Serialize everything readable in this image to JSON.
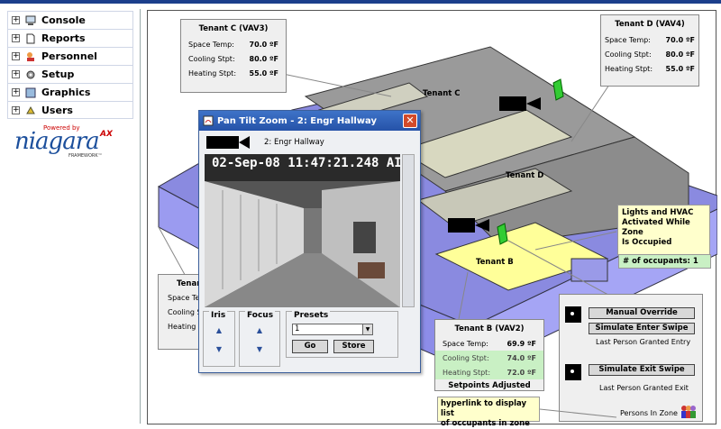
{
  "nav": {
    "items": [
      {
        "label": "Console",
        "icon": "console-icon"
      },
      {
        "label": "Reports",
        "icon": "reports-icon"
      },
      {
        "label": "Personnel",
        "icon": "personnel-icon"
      },
      {
        "label": "Setup",
        "icon": "setup-icon"
      },
      {
        "label": "Graphics",
        "icon": "graphics-icon"
      },
      {
        "label": "Users",
        "icon": "users-icon"
      }
    ],
    "expand_symbol": "+"
  },
  "logo": {
    "powered": "Powered by",
    "brand": "niagara",
    "ax": "AX",
    "framework": "FRAMEWORK™"
  },
  "floor": {
    "tenant_c": "Tenant C",
    "tenant_d": "Tenant D",
    "tenant_b": "Tenant B"
  },
  "tenant_c_box": {
    "title": "Tenant C (VAV3)",
    "rows": [
      {
        "label": "Space Temp:",
        "value": "70.0 ºF"
      },
      {
        "label": "Cooling Stpt:",
        "value": "80.0 ºF"
      },
      {
        "label": "Heating Stpt:",
        "value": "55.0 ºF"
      }
    ]
  },
  "tenant_d_box": {
    "title": "Tenant D (VAV4)",
    "rows": [
      {
        "label": "Space Temp:",
        "value": "70.0 ºF"
      },
      {
        "label": "Cooling Stpt:",
        "value": "80.0 ºF"
      },
      {
        "label": "Heating Stpt:",
        "value": "55.0 ºF"
      }
    ]
  },
  "tenant_a_box": {
    "title": "Tenan",
    "rows": [
      {
        "label": "Space Tem"
      },
      {
        "label": "Cooling St"
      },
      {
        "label": "Heating St"
      }
    ]
  },
  "tenant_b_box": {
    "title": "Tenant B (VAV2)",
    "rows": [
      {
        "label": "Space Temp:",
        "value": "69.9 ºF"
      },
      {
        "label": "Cooling Stpt:",
        "value": "74.0 ºF"
      },
      {
        "label": "Heating Stpt:",
        "value": "72.0 ºF"
      }
    ],
    "footer": "Setpoints Adjusted"
  },
  "callout": {
    "lines": [
      "Lights and HVAC",
      "Activated While Zone",
      "Is Occupied"
    ],
    "occupants": "# of occupants: 1"
  },
  "access_panel": {
    "manual_override": "Manual Override",
    "enter_swipe": "Simulate Enter Swipe",
    "enter_caption": "Last Person Granted Entry",
    "exit_swipe": "Simulate Exit Swipe",
    "exit_caption": "Last Person Granted Exit",
    "persons_in_zone": "Persons In Zone"
  },
  "hyperlink_note": {
    "lines": [
      "hyperlink to display list",
      "of occupants in zone"
    ]
  },
  "ptz": {
    "title": "Pan Tilt Zoom - 2: Engr Hallway",
    "camera_label": "2: Engr Hallway",
    "timestamp": "02-Sep-08 11:47:21.248 AI",
    "iris_label": "Iris",
    "focus_label": "Focus",
    "presets_label": "Presets",
    "preset_value": "1",
    "go_label": "Go",
    "store_label": "Store",
    "close_symbol": "✕"
  },
  "colors": {
    "floor_blue": "#9b9bf0",
    "room_gray": "#9a9a9a",
    "tenant_b_yellow": "#ffff99",
    "title_blue": "#2552a8"
  }
}
